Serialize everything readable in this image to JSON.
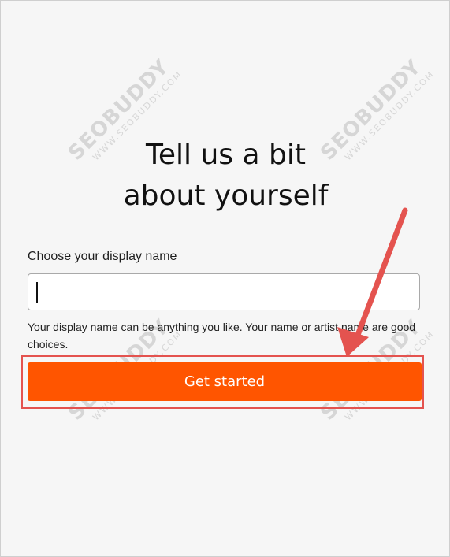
{
  "heading": {
    "line1": "Tell us a bit",
    "line2": "about yourself"
  },
  "form": {
    "display_name_label": "Choose your display name",
    "display_name_value": "",
    "helper_text": "Your display name can be anything you like. Your name or artist name are good choices.",
    "submit_label": "Get started"
  },
  "colors": {
    "primary_button": "#ff5500",
    "annotation_red": "#e4534f"
  },
  "watermark": {
    "brand": "SEOBUDDY",
    "site": "WWW.SEOBUDDY.COM"
  }
}
